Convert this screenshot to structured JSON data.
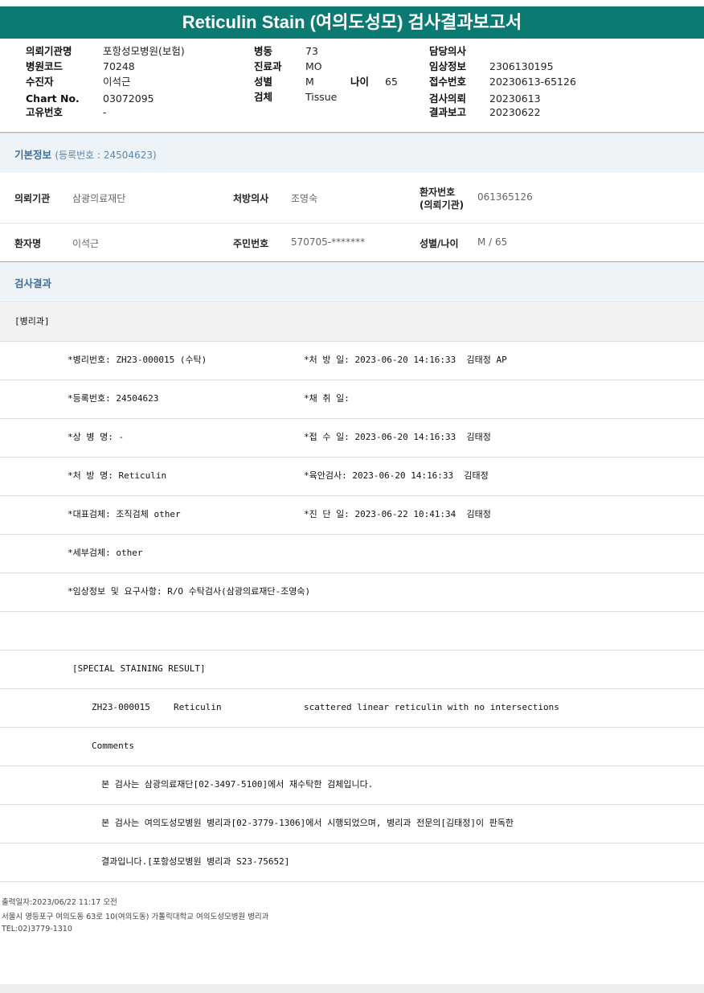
{
  "title": "Reticulin Stain (여의도성모) 검사결과보고서",
  "header": {
    "col1": [
      {
        "label": "의뢰기관명",
        "value": "포항성모병원(보험)"
      },
      {
        "label": "병원코드",
        "value": "70248"
      },
      {
        "label": "수진자",
        "value": "이석근"
      },
      {
        "label": "Chart No.",
        "value": "03072095"
      },
      {
        "label": "고유번호",
        "value": "-"
      }
    ],
    "col2": [
      {
        "label": "병동",
        "value": "73"
      },
      {
        "label": "진료과",
        "value": "MO"
      },
      {
        "label": "성별",
        "value": "M"
      },
      {
        "label": "검체",
        "value": "Tissue"
      }
    ],
    "age": {
      "label": "나이",
      "value": "65"
    },
    "col3": [
      {
        "label": "담당의사",
        "value": ""
      },
      {
        "label": "임상정보",
        "value": "2306130195"
      },
      {
        "label": "접수번호",
        "value": "20230613-65126"
      },
      {
        "label": "검사의뢰",
        "value": "20230613"
      },
      {
        "label": "결과보고",
        "value": "20230622"
      }
    ]
  },
  "basic": {
    "title": "기본정보",
    "reg": "(등록번호 : 24504623)",
    "row1": [
      {
        "label": "의뢰기관",
        "value": "삼광의료재단"
      },
      {
        "label": "처방의사",
        "value": "조영숙"
      },
      {
        "label": "환자번호",
        "label2": "(의뢰기관)",
        "value": "061365126"
      }
    ],
    "row2": [
      {
        "label": "환자명",
        "value": "이석근"
      },
      {
        "label": "주민번호",
        "value": "570705-*******"
      },
      {
        "label": "성별/나이",
        "value": "M / 65"
      }
    ]
  },
  "result": {
    "title": "검사결과",
    "dept": "[병리과]",
    "rows": [
      {
        "left": "*병리번호: ZH23-000015 (수탁)",
        "right": "*처 방 일: 2023-06-20 14:16:33  김태정 AP"
      },
      {
        "left": "*등록번호: 24504623",
        "right": "*채 취 일:"
      },
      {
        "left": "*상 병 명: -",
        "right": "*접 수 일: 2023-06-20 14:16:33  김태정"
      },
      {
        "left": "*처 방 명: Reticulin",
        "right": "*육안검사: 2023-06-20 14:16:33  김태정"
      },
      {
        "left": "*대표검체: 조직검체 other",
        "right": "*진 단 일: 2023-06-22 10:41:34  김태정"
      },
      {
        "left": "*세부검체: other",
        "right": ""
      },
      {
        "left": "*임상정보 및 요구사항: R/O 수탁검사(삼광의료재단-조영숙)",
        "right": ""
      },
      {
        "left": "",
        "right": ""
      }
    ],
    "special_title": "[SPECIAL STAINING RESULT]",
    "special_id": "ZH23-000015",
    "special_stain": "Reticulin",
    "special_result": "scattered linear reticulin with no intersections",
    "comments_label": "Comments",
    "comments": [
      "본 검사는 삼광의료재단[02-3497-5100]에서 재수탁한 검체입니다.",
      "본 검사는 여의도성모병원 병리과[02-3779-1306]에서 시행되었으며, 병리과 전문의[김태정]이 판독한",
      "결과입니다.[포항성모병원 병리과 S23-75652]"
    ]
  },
  "footer": {
    "printed": "출력일자:2023/06/22 11:17 오전",
    "address": "서울시 영등포구 여의도동 63로 10(여의도동) 가톨릭대학교 여의도성모병원 병리과",
    "tel": "TEL:02)3779-1310"
  },
  "colors": {
    "title_bar": "#0b7a72",
    "section_bg": "#eef3f8",
    "section_title": "#3d6f9a"
  }
}
